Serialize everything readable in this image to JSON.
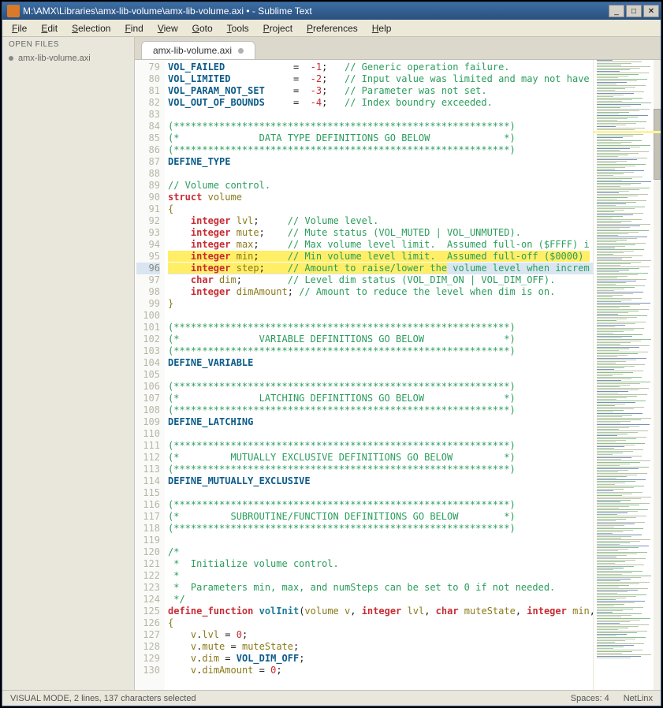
{
  "window": {
    "title": "M:\\AMX\\Libraries\\amx-lib-volume\\amx-lib-volume.axi • - Sublime Text"
  },
  "menu": [
    "File",
    "Edit",
    "Selection",
    "Find",
    "View",
    "Goto",
    "Tools",
    "Project",
    "Preferences",
    "Help"
  ],
  "sidebar": {
    "header": "OPEN FILES",
    "items": [
      {
        "label": "amx-lib-volume.axi"
      }
    ]
  },
  "tab": {
    "label": "amx-lib-volume.axi"
  },
  "status": {
    "left": "VISUAL MODE, 2 lines, 137 characters selected",
    "spaces": "Spaces: 4",
    "syntax": "NetLinx"
  },
  "code_lines": [
    {
      "n": 79,
      "cls": "",
      "seg": [
        [
          "tok-const",
          "VOL_FAILED            "
        ],
        [
          "tok-op",
          "=  "
        ],
        [
          "tok-num",
          "-1"
        ],
        [
          "tok-op",
          ";   "
        ],
        [
          "tok-cmt",
          "// Generic operation failure."
        ]
      ]
    },
    {
      "n": 80,
      "cls": "",
      "seg": [
        [
          "tok-const",
          "VOL_LIMITED           "
        ],
        [
          "tok-op",
          "=  "
        ],
        [
          "tok-num",
          "-2"
        ],
        [
          "tok-op",
          ";   "
        ],
        [
          "tok-cmt",
          "// Input value was limited and may not have r"
        ]
      ]
    },
    {
      "n": 81,
      "cls": "",
      "seg": [
        [
          "tok-const",
          "VOL_PARAM_NOT_SET     "
        ],
        [
          "tok-op",
          "=  "
        ],
        [
          "tok-num",
          "-3"
        ],
        [
          "tok-op",
          ";   "
        ],
        [
          "tok-cmt",
          "// Parameter was not set."
        ]
      ]
    },
    {
      "n": 82,
      "cls": "",
      "seg": [
        [
          "tok-const",
          "VOL_OUT_OF_BOUNDS     "
        ],
        [
          "tok-op",
          "=  "
        ],
        [
          "tok-num",
          "-4"
        ],
        [
          "tok-op",
          ";   "
        ],
        [
          "tok-cmt",
          "// Index boundry exceeded."
        ]
      ]
    },
    {
      "n": 83,
      "cls": "",
      "seg": [
        [
          "",
          ""
        ]
      ]
    },
    {
      "n": 84,
      "cls": "",
      "seg": [
        [
          "tok-cmt",
          "(***********************************************************)"
        ]
      ]
    },
    {
      "n": 85,
      "cls": "",
      "seg": [
        [
          "tok-cmt",
          "(*              DATA TYPE DEFINITIONS GO BELOW             *)"
        ]
      ]
    },
    {
      "n": 86,
      "cls": "",
      "seg": [
        [
          "tok-cmt",
          "(***********************************************************)"
        ]
      ]
    },
    {
      "n": 87,
      "cls": "",
      "seg": [
        [
          "tok-dir",
          "DEFINE_TYPE"
        ]
      ]
    },
    {
      "n": 88,
      "cls": "",
      "seg": [
        [
          "",
          ""
        ]
      ]
    },
    {
      "n": 89,
      "cls": "",
      "seg": [
        [
          "tok-cmt",
          "// Volume control."
        ]
      ]
    },
    {
      "n": 90,
      "cls": "",
      "seg": [
        [
          "tok-kw",
          "struct"
        ],
        [
          "",
          " "
        ],
        [
          "tok-id",
          "volume"
        ]
      ]
    },
    {
      "n": 91,
      "cls": "",
      "seg": [
        [
          "tok-brace",
          "{"
        ]
      ]
    },
    {
      "n": 92,
      "cls": "",
      "seg": [
        [
          "",
          "    "
        ],
        [
          "tok-kw",
          "integer"
        ],
        [
          "",
          " "
        ],
        [
          "tok-id",
          "lvl"
        ],
        [
          "tok-op",
          ";     "
        ],
        [
          "tok-cmt",
          "// Volume level."
        ]
      ]
    },
    {
      "n": 93,
      "cls": "",
      "seg": [
        [
          "",
          "    "
        ],
        [
          "tok-kw",
          "integer"
        ],
        [
          "",
          " "
        ],
        [
          "tok-id",
          "mute"
        ],
        [
          "tok-op",
          ";    "
        ],
        [
          "tok-cmt",
          "// Mute status (VOL_MUTED | VOL_UNMUTED)."
        ]
      ]
    },
    {
      "n": 94,
      "cls": "",
      "seg": [
        [
          "",
          "    "
        ],
        [
          "tok-kw",
          "integer"
        ],
        [
          "",
          " "
        ],
        [
          "tok-id",
          "max"
        ],
        [
          "tok-op",
          ";     "
        ],
        [
          "tok-cmt",
          "// Max volume level limit.  Assumed full-on ($FFFF) i"
        ]
      ]
    },
    {
      "n": 95,
      "cls": "hl",
      "seg": [
        [
          "",
          "    "
        ],
        [
          "tok-kw",
          "integer"
        ],
        [
          "",
          " "
        ],
        [
          "tok-id",
          "min"
        ],
        [
          "tok-op",
          ";     "
        ],
        [
          "tok-cmt",
          "// Min volume level limit.  Assumed full-off ($0000) "
        ]
      ]
    },
    {
      "n": 96,
      "cls": "cursor hl-partial",
      "seg_a": [
        [
          "",
          "    "
        ],
        [
          "tok-kw",
          "integer"
        ],
        [
          "",
          " "
        ],
        [
          "tok-id",
          "step"
        ],
        [
          "tok-op",
          ";    "
        ],
        [
          "tok-cmt",
          "// Amount to raise/lower the"
        ]
      ],
      "seg_b": [
        [
          "tok-cmt",
          " volume level when increm"
        ]
      ]
    },
    {
      "n": 97,
      "cls": "",
      "seg": [
        [
          "",
          "    "
        ],
        [
          "tok-kw",
          "char"
        ],
        [
          "",
          " "
        ],
        [
          "tok-id",
          "dim"
        ],
        [
          "tok-op",
          ";        "
        ],
        [
          "tok-cmt",
          "// Level dim status (VOL_DIM_ON | VOL_DIM_OFF)."
        ]
      ]
    },
    {
      "n": 98,
      "cls": "",
      "seg": [
        [
          "",
          "    "
        ],
        [
          "tok-kw",
          "integer"
        ],
        [
          "",
          " "
        ],
        [
          "tok-id",
          "dimAmount"
        ],
        [
          "tok-op",
          "; "
        ],
        [
          "tok-cmt",
          "// Amount to reduce the level when dim is on."
        ]
      ]
    },
    {
      "n": 99,
      "cls": "",
      "seg": [
        [
          "tok-brace",
          "}"
        ]
      ]
    },
    {
      "n": 100,
      "cls": "",
      "seg": [
        [
          "",
          ""
        ]
      ]
    },
    {
      "n": 101,
      "cls": "",
      "seg": [
        [
          "tok-cmt",
          "(***********************************************************)"
        ]
      ]
    },
    {
      "n": 102,
      "cls": "",
      "seg": [
        [
          "tok-cmt",
          "(*              VARIABLE DEFINITIONS GO BELOW              *)"
        ]
      ]
    },
    {
      "n": 103,
      "cls": "",
      "seg": [
        [
          "tok-cmt",
          "(***********************************************************)"
        ]
      ]
    },
    {
      "n": 104,
      "cls": "",
      "seg": [
        [
          "tok-dir",
          "DEFINE_VARIABLE"
        ]
      ]
    },
    {
      "n": 105,
      "cls": "",
      "seg": [
        [
          "",
          ""
        ]
      ]
    },
    {
      "n": 106,
      "cls": "",
      "seg": [
        [
          "tok-cmt",
          "(***********************************************************)"
        ]
      ]
    },
    {
      "n": 107,
      "cls": "",
      "seg": [
        [
          "tok-cmt",
          "(*              LATCHING DEFINITIONS GO BELOW              *)"
        ]
      ]
    },
    {
      "n": 108,
      "cls": "",
      "seg": [
        [
          "tok-cmt",
          "(***********************************************************)"
        ]
      ]
    },
    {
      "n": 109,
      "cls": "",
      "seg": [
        [
          "tok-dir",
          "DEFINE_LATCHING"
        ]
      ]
    },
    {
      "n": 110,
      "cls": "",
      "seg": [
        [
          "",
          ""
        ]
      ]
    },
    {
      "n": 111,
      "cls": "",
      "seg": [
        [
          "tok-cmt",
          "(***********************************************************)"
        ]
      ]
    },
    {
      "n": 112,
      "cls": "",
      "seg": [
        [
          "tok-cmt",
          "(*         MUTUALLY EXCLUSIVE DEFINITIONS GO BELOW         *)"
        ]
      ]
    },
    {
      "n": 113,
      "cls": "",
      "seg": [
        [
          "tok-cmt",
          "(***********************************************************)"
        ]
      ]
    },
    {
      "n": 114,
      "cls": "",
      "seg": [
        [
          "tok-dir",
          "DEFINE_MUTUALLY_EXCLUSIVE"
        ]
      ]
    },
    {
      "n": 115,
      "cls": "",
      "seg": [
        [
          "",
          ""
        ]
      ]
    },
    {
      "n": 116,
      "cls": "",
      "seg": [
        [
          "tok-cmt",
          "(***********************************************************)"
        ]
      ]
    },
    {
      "n": 117,
      "cls": "",
      "seg": [
        [
          "tok-cmt",
          "(*         SUBROUTINE/FUNCTION DEFINITIONS GO BELOW        *)"
        ]
      ]
    },
    {
      "n": 118,
      "cls": "",
      "seg": [
        [
          "tok-cmt",
          "(***********************************************************)"
        ]
      ]
    },
    {
      "n": 119,
      "cls": "",
      "seg": [
        [
          "",
          ""
        ]
      ]
    },
    {
      "n": 120,
      "cls": "",
      "seg": [
        [
          "tok-cmt",
          "/*"
        ]
      ]
    },
    {
      "n": 121,
      "cls": "",
      "seg": [
        [
          "tok-cmt",
          " *  Initialize volume control."
        ]
      ]
    },
    {
      "n": 122,
      "cls": "",
      "seg": [
        [
          "tok-cmt",
          " *"
        ]
      ]
    },
    {
      "n": 123,
      "cls": "",
      "seg": [
        [
          "tok-cmt",
          " *  Parameters min, max, and numSteps can be set to 0 if not needed."
        ]
      ]
    },
    {
      "n": 124,
      "cls": "",
      "seg": [
        [
          "tok-cmt",
          " */"
        ]
      ]
    },
    {
      "n": 125,
      "cls": "",
      "seg": [
        [
          "tok-kw",
          "define_function"
        ],
        [
          "",
          " "
        ],
        [
          "tok-fn",
          "volInit"
        ],
        [
          "tok-op",
          "("
        ],
        [
          "tok-id",
          "volume"
        ],
        [
          "",
          " "
        ],
        [
          "tok-id",
          "v"
        ],
        [
          "tok-op",
          ", "
        ],
        [
          "tok-kw",
          "integer"
        ],
        [
          "",
          " "
        ],
        [
          "tok-id",
          "lvl"
        ],
        [
          "tok-op",
          ", "
        ],
        [
          "tok-kw",
          "char"
        ],
        [
          "",
          " "
        ],
        [
          "tok-id",
          "muteState"
        ],
        [
          "tok-op",
          ", "
        ],
        [
          "tok-kw",
          "integer"
        ],
        [
          "",
          " "
        ],
        [
          "tok-id",
          "min"
        ],
        [
          "tok-op",
          ", "
        ],
        [
          "tok-kw",
          "i"
        ]
      ]
    },
    {
      "n": 126,
      "cls": "",
      "seg": [
        [
          "tok-brace",
          "{"
        ]
      ]
    },
    {
      "n": 127,
      "cls": "",
      "seg": [
        [
          "",
          "    "
        ],
        [
          "tok-id",
          "v"
        ],
        [
          "tok-op",
          "."
        ],
        [
          "tok-id",
          "lvl"
        ],
        [
          "tok-op",
          " = "
        ],
        [
          "tok-num",
          "0"
        ],
        [
          "tok-op",
          ";"
        ]
      ]
    },
    {
      "n": 128,
      "cls": "",
      "seg": [
        [
          "",
          "    "
        ],
        [
          "tok-id",
          "v"
        ],
        [
          "tok-op",
          "."
        ],
        [
          "tok-id",
          "mute"
        ],
        [
          "tok-op",
          " = "
        ],
        [
          "tok-id",
          "muteState"
        ],
        [
          "tok-op",
          ";"
        ]
      ]
    },
    {
      "n": 129,
      "cls": "",
      "seg": [
        [
          "",
          "    "
        ],
        [
          "tok-id",
          "v"
        ],
        [
          "tok-op",
          "."
        ],
        [
          "tok-id",
          "dim"
        ],
        [
          "tok-op",
          " = "
        ],
        [
          "tok-const",
          "VOL_DIM_OFF"
        ],
        [
          "tok-op",
          ";"
        ]
      ]
    },
    {
      "n": 130,
      "cls": "",
      "seg": [
        [
          "",
          "    "
        ],
        [
          "tok-id",
          "v"
        ],
        [
          "tok-op",
          "."
        ],
        [
          "tok-id",
          "dimAmount"
        ],
        [
          "tok-op",
          " = "
        ],
        [
          "tok-num",
          "0"
        ],
        [
          "tok-op",
          ";"
        ]
      ]
    }
  ]
}
